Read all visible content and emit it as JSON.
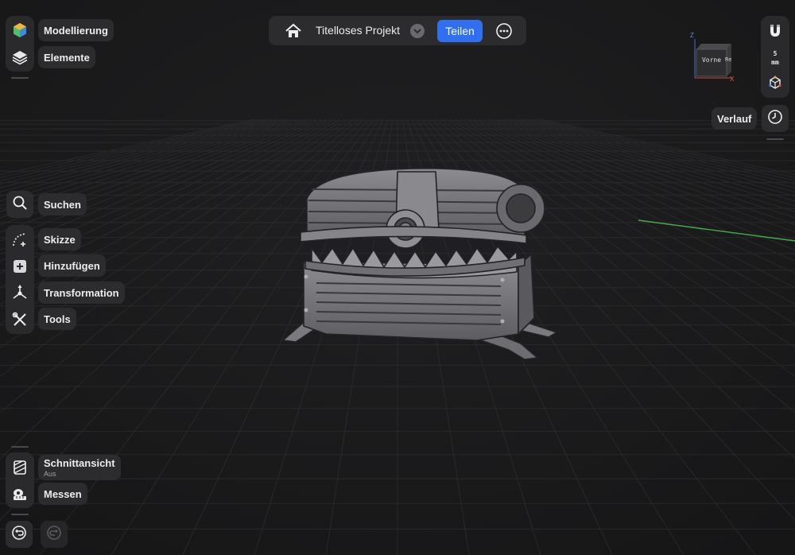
{
  "project": {
    "title": "Titelloses Projekt",
    "share_label": "Teilen"
  },
  "top_left": {
    "modeling_label": "Modellierung",
    "elements_label": "Elemente"
  },
  "tools": {
    "search_label": "Suchen",
    "sketch_label": "Skizze",
    "add_label": "Hinzufügen",
    "transform_label": "Transformation",
    "tools_label": "Tools"
  },
  "bottom": {
    "section_label": "Schnittansicht",
    "section_state": "Aus",
    "measure_label": "Messen"
  },
  "right": {
    "grid_value": "5",
    "grid_unit": "mm",
    "history_label": "Verlauf",
    "view_cube_face": "Vorne",
    "view_cube_side": "Re",
    "axis_z": "Z",
    "axis_x": "X"
  },
  "colors": {
    "accent": "#2f6ff0",
    "panel": "#2c2c2e",
    "background": "#1b1b1c",
    "axis_green": "#3fae49"
  }
}
